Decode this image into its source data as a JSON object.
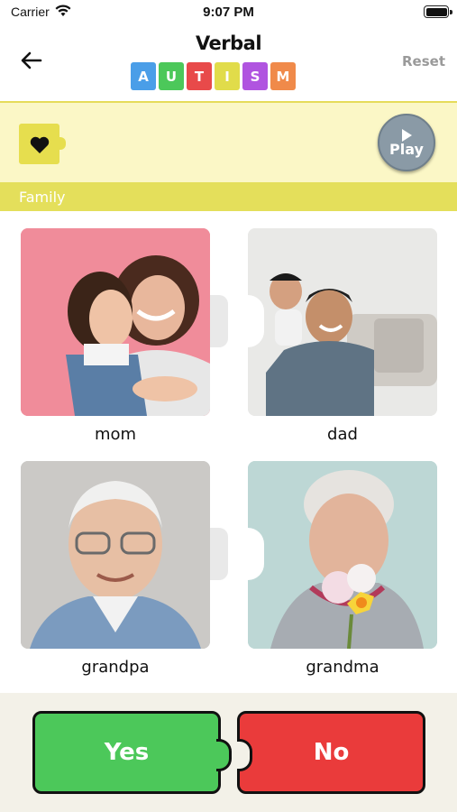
{
  "status_bar": {
    "carrier": "Carrier",
    "time": "9:07 PM"
  },
  "header": {
    "title": "Verbal",
    "logo_letters": [
      "A",
      "U",
      "T",
      "I",
      "S",
      "M"
    ],
    "logo_colors": [
      "#4a9ee8",
      "#4cc85a",
      "#e84a4a",
      "#e1dc4a",
      "#b054e0",
      "#f08a4a"
    ],
    "reset_label": "Reset"
  },
  "sentence_bar": {
    "play_label": "Play",
    "selected_icon": "heart-icon"
  },
  "category": {
    "name": "Family"
  },
  "cards": [
    {
      "label": "mom"
    },
    {
      "label": "dad"
    },
    {
      "label": "grandpa"
    },
    {
      "label": "grandma"
    }
  ],
  "footer": {
    "yes_label": "Yes",
    "no_label": "No"
  },
  "colors": {
    "yes": "#4cc85a",
    "no": "#ea3b3b",
    "accent_yellow": "#e4df5b",
    "sentence_bg": "#fbf7c6"
  }
}
